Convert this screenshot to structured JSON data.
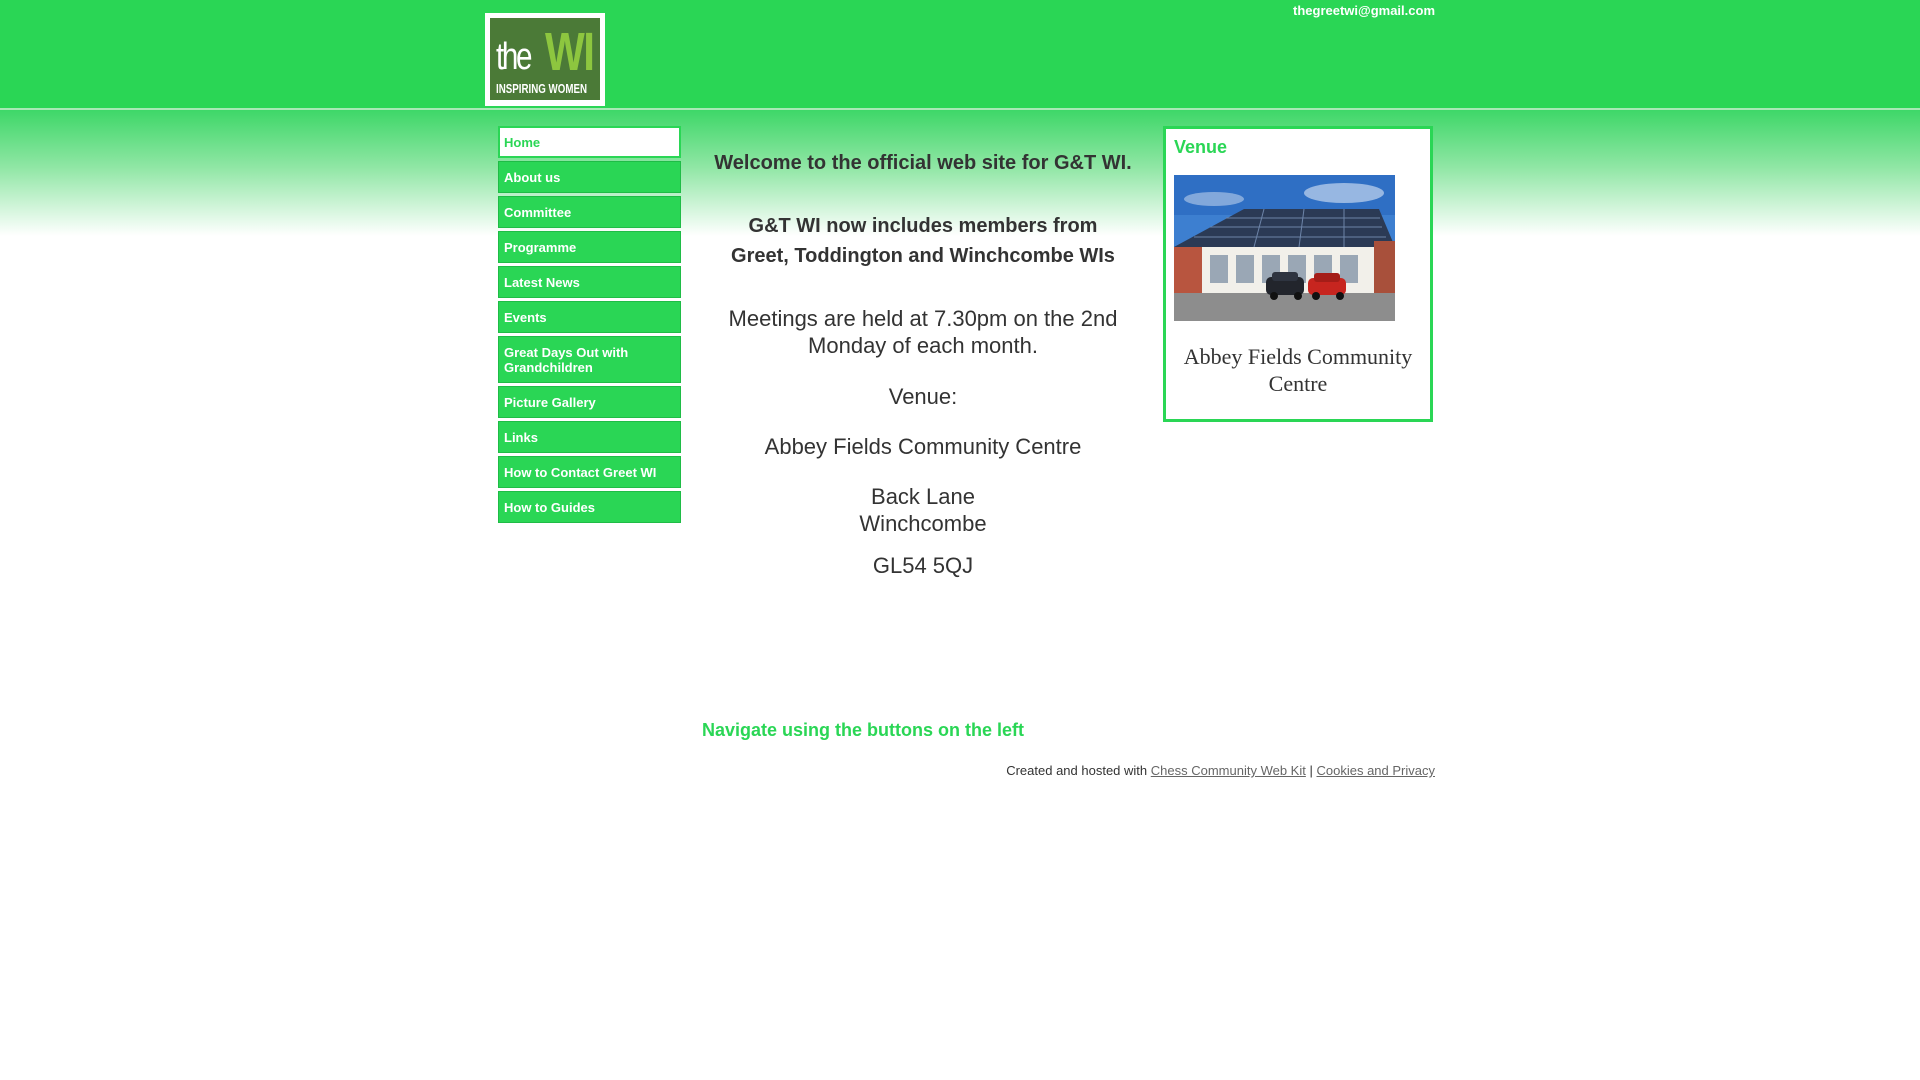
{
  "header": {
    "email": "thegreetwi@gmail.com",
    "logo": {
      "word_the": "the",
      "word_wi": "WI",
      "tagline": "INSPIRING WOMEN"
    }
  },
  "nav": {
    "items": [
      {
        "label": "Home",
        "active": true
      },
      {
        "label": "About us",
        "active": false
      },
      {
        "label": "Committee",
        "active": false
      },
      {
        "label": "Programme",
        "active": false
      },
      {
        "label": "Latest News",
        "active": false
      },
      {
        "label": "Events",
        "active": false
      },
      {
        "label": "Great Days Out with Grandchildren",
        "active": false
      },
      {
        "label": "Picture Gallery",
        "active": false
      },
      {
        "label": "Links",
        "active": false
      },
      {
        "label": "How to Contact Greet WI",
        "active": false
      },
      {
        "label": "How to Guides",
        "active": false
      }
    ]
  },
  "main": {
    "welcome": "Welcome to the official web site for G&T WI.",
    "includes_line1": "G&T WI now includes members from",
    "includes_line2": "Greet, Toddington and Winchcombe WIs",
    "meetings_line1": "Meetings are held at 7.30pm on the 2nd",
    "meetings_line2": "Monday of each month.",
    "venue_label": "Venue:",
    "venue_name": "Abbey Fields Community Centre",
    "address_line1": "Back Lane",
    "address_line2": "Winchcombe",
    "postcode": "GL54 5QJ",
    "navigate_hint": "Navigate using the buttons on the left"
  },
  "sidebar_box": {
    "title": "Venue",
    "caption_line1": "Abbey Fields Community",
    "caption_line2": "Centre"
  },
  "footer": {
    "prefix": "Created and hosted with",
    "link1": "Chess Community Web Kit",
    "separator": "|",
    "link2": "Cookies and Privacy"
  },
  "colors": {
    "brand_green": "#2ad655",
    "logo_green": "#4b7a37",
    "text": "#333333"
  }
}
